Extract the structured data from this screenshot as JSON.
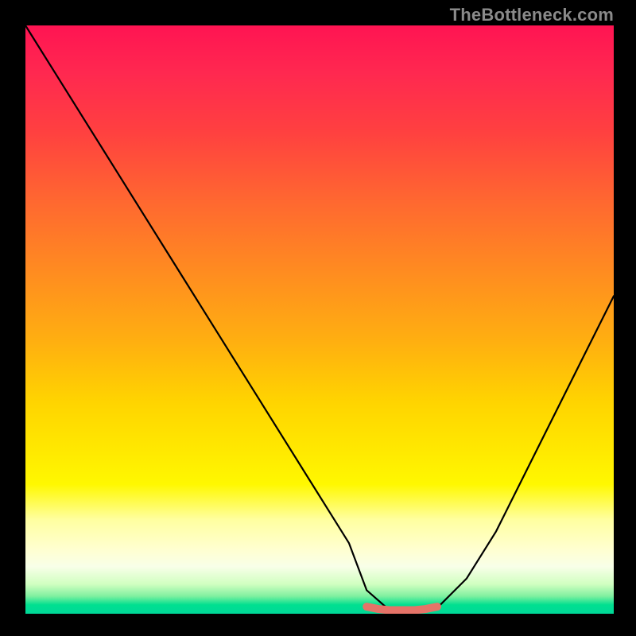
{
  "watermark": "TheBottleneck.com",
  "chart_data": {
    "type": "line",
    "title": "",
    "xlabel": "",
    "ylabel": "",
    "xlim": [
      0,
      100
    ],
    "ylim": [
      0,
      100
    ],
    "grid": false,
    "legend": false,
    "series": [
      {
        "name": "curve",
        "color": "#000000",
        "x": [
          0,
          5,
          10,
          15,
          20,
          25,
          30,
          35,
          40,
          45,
          50,
          55,
          58,
          62,
          66,
          70,
          75,
          80,
          85,
          90,
          95,
          100
        ],
        "y": [
          100,
          92,
          84,
          76,
          68,
          60,
          52,
          44,
          36,
          28,
          20,
          12,
          4,
          0.5,
          0.5,
          1,
          6,
          14,
          24,
          34,
          44,
          54
        ]
      },
      {
        "name": "highlight",
        "color": "#e57368",
        "x": [
          58,
          60,
          62,
          64,
          66,
          68,
          70
        ],
        "y": [
          1.2,
          0.8,
          0.6,
          0.6,
          0.6,
          0.8,
          1.2
        ]
      }
    ],
    "background_gradient": {
      "direction": "vertical",
      "stops": [
        {
          "pos": 0,
          "color": "#ff1452"
        },
        {
          "pos": 18,
          "color": "#ff4040"
        },
        {
          "pos": 42,
          "color": "#ff8c20"
        },
        {
          "pos": 64,
          "color": "#ffd400"
        },
        {
          "pos": 84,
          "color": "#ffffa0"
        },
        {
          "pos": 95,
          "color": "#d0ffc0"
        },
        {
          "pos": 100,
          "color": "#00d898"
        }
      ]
    }
  }
}
